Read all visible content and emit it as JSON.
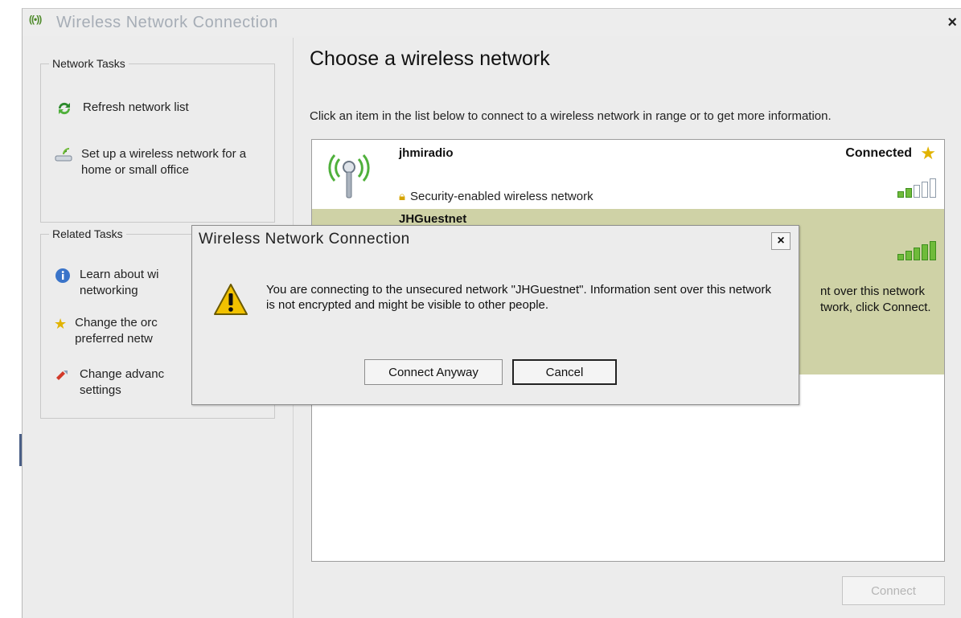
{
  "window": {
    "title": "Wireless Network Connection",
    "app_icon": "((•))",
    "close_glyph": "×"
  },
  "sidebar": {
    "network_tasks": {
      "title": "Network Tasks",
      "items": [
        {
          "label": "Refresh network list",
          "icon": "refresh-icon"
        },
        {
          "label": "Set up a wireless network for a home or small office",
          "icon": "setup-network-icon"
        }
      ]
    },
    "related_tasks": {
      "title": "Related Tasks",
      "items": [
        {
          "label": "Learn about wi networking",
          "icon": "info-icon"
        },
        {
          "label": "Change the orc preferred netw",
          "icon": "star-icon"
        },
        {
          "label": "Change advanc settings",
          "icon": "settings-icon"
        }
      ]
    }
  },
  "main": {
    "heading": "Choose a wireless network",
    "description": "Click an item in the list below to connect to a wireless network in range or to get more information.",
    "networks": [
      {
        "name": "jhmiradio",
        "status": "Connected",
        "security": "Security-enabled wireless network",
        "signal_bars": 2
      },
      {
        "name": "JHGuestnet",
        "signal_bars": 5,
        "visible_fragment_1": "nt over this network",
        "visible_fragment_2": "twork, click Connect."
      }
    ],
    "connect_button": "Connect"
  },
  "dialog": {
    "title": "Wireless Network Connection",
    "close_glyph": "×",
    "message": "You are connecting to the unsecured network \"JHGuestnet\". Information sent over this network is not encrypted and might be visible to other people.",
    "buttons": {
      "connect_anyway": "Connect Anyway",
      "cancel": "Cancel"
    }
  },
  "colors": {
    "selected_row": "#cfd2a6",
    "signal_green": "#6fbb3a",
    "warning_yellow": "#f2c200"
  }
}
